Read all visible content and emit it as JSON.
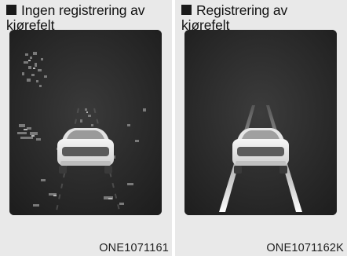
{
  "panels": [
    {
      "title_line1": "Ingen registrering av",
      "title_line2": "kjørefelt",
      "code": "ONE1071161"
    },
    {
      "title_line1": "Registrering av",
      "title_line2": "kjørefelt",
      "code": "ONE1071162K"
    }
  ]
}
